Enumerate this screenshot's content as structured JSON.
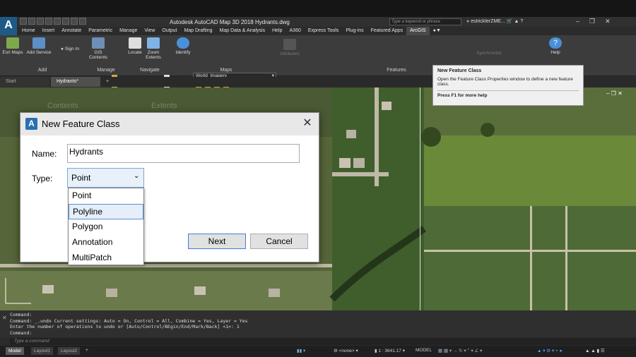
{
  "app": {
    "icon_letter": "A",
    "title": "Autodesk AutoCAD Map 3D 2018   Hydrants.dwg",
    "search_placeholder": "Type a keyword or phrase",
    "user": "estricklerZME..."
  },
  "menubar": {
    "tabs": [
      "Home",
      "Insert",
      "Annotate",
      "Parametric",
      "Manage",
      "View",
      "Output",
      "Map Drafting",
      "Map Data & Analysis",
      "Help",
      "A360",
      "Express Tools",
      "Plug-ins",
      "Featured Apps",
      "ArcGIS"
    ],
    "active": "ArcGIS"
  },
  "ribbon": {
    "buttons": {
      "esri_maps": "Esri Maps",
      "add_service": "Add Service",
      "sign_in": "Sign In",
      "gis_contents_1": "GIS",
      "gis_contents_2": "Contents",
      "locate": "Locate",
      "zoom_extents_1": "Zoom",
      "zoom_extents_2": "Extents",
      "identify": "Identify",
      "attributes": "Attributes",
      "synchronize": "Synchronize",
      "help": "Help"
    },
    "basemap_value": "World_Imagery",
    "panels": {
      "add": "Add",
      "manage": "Manage",
      "navigate": "Navigate",
      "maps": "Maps",
      "features": "Features"
    }
  },
  "doc_tabs": [
    "Start",
    "Hydrants*"
  ],
  "tooltip": {
    "title": "New Feature Class",
    "body": "Open the Feature Class Properties window to define a new feature class.",
    "help": "Press F1 for more help"
  },
  "dialog": {
    "title": "New Feature Class",
    "name_label": "Name:",
    "name_value": "Hydrants",
    "type_label": "Type:",
    "type_value": "Point",
    "options": [
      "Point",
      "Polyline",
      "Polygon",
      "Annotation",
      "MultiPatch"
    ],
    "highlighted_option": "Polyline",
    "next": "Next",
    "cancel": "Cancel"
  },
  "background_ghost": {
    "contents": "Contents",
    "extents": "Extents"
  },
  "command": {
    "lines": [
      "Command:",
      "Command: _.undo Current settings: Auto = On, Control = All, Combine = Yes, Layer = Yes",
      "Enter the number of operations to undo or [Auto/Control/BEgin/End/Mark/Back] <1>: 1",
      "Command:"
    ],
    "input_placeholder": "Type a command"
  },
  "status": {
    "layout_tabs": [
      "Model",
      "Layout1",
      "Layout2"
    ],
    "active_layout": "Model",
    "coord_sys": "<none>",
    "scale": "1 : 3641.17",
    "space": "MODEL"
  },
  "colors": {
    "ribbon_bg": "#3c3c3c",
    "accent_blue": "#2a6fb0",
    "button_focus": "#3f7ed8"
  }
}
